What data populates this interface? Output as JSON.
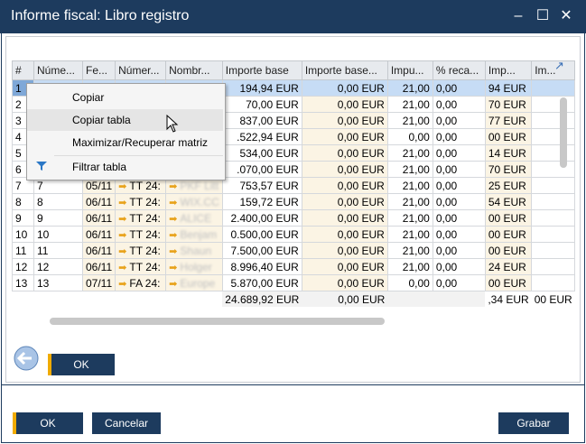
{
  "window": {
    "title": "Informe fiscal: Libro registro"
  },
  "columns": [
    "#",
    "Núme...",
    "Fe...",
    "Númer...",
    "Nombr...",
    "Importe base",
    "Importe base...",
    "Impu...",
    "% reca...",
    "Imp...",
    "Im..."
  ],
  "rows": [
    {
      "n": "1",
      "num": "",
      "fecha": "",
      "numdoc": "",
      "nombre": "",
      "base": "194,94 EUR",
      "base2": "0,00 EUR",
      "imp": "21,00",
      "rec": "0,00",
      "imp2": "94 EUR"
    },
    {
      "n": "2",
      "num": "",
      "fecha": "",
      "numdoc": "",
      "nombre": "",
      "base": "70,00 EUR",
      "base2": "0,00 EUR",
      "imp": "21,00",
      "rec": "0,00",
      "imp2": "70 EUR"
    },
    {
      "n": "3",
      "num": "",
      "fecha": "",
      "numdoc": "",
      "nombre": "",
      "base": "837,00 EUR",
      "base2": "0,00 EUR",
      "imp": "21,00",
      "rec": "0,00",
      "imp2": "77 EUR"
    },
    {
      "n": "4",
      "num": "",
      "fecha": "",
      "numdoc": "",
      "nombre": "",
      "base": ".522,94 EUR",
      "base2": "0,00 EUR",
      "imp": "0,00",
      "rec": "0,00",
      "imp2": "00 EUR"
    },
    {
      "n": "5",
      "num": "",
      "fecha": "",
      "numdoc": "",
      "nombre": "",
      "base": "534,00 EUR",
      "base2": "0,00 EUR",
      "imp": "21,00",
      "rec": "0,00",
      "imp2": "14 EUR"
    },
    {
      "n": "6",
      "num": "",
      "fecha": "",
      "numdoc": "",
      "nombre": "",
      "base": ".070,00 EUR",
      "base2": "0,00 EUR",
      "imp": "21,00",
      "rec": "0,00",
      "imp2": "70 EUR"
    },
    {
      "n": "7",
      "num": "7",
      "fecha": "05/11",
      "numdoc": "TT 24:",
      "nombre": "PKF Litt",
      "base": "753,57 EUR",
      "base2": "0,00 EUR",
      "imp": "21,00",
      "rec": "0,00",
      "imp2": "25 EUR"
    },
    {
      "n": "8",
      "num": "8",
      "fecha": "06/11",
      "numdoc": "TT 24:",
      "nombre": "WIX.CC",
      "base": "159,72 EUR",
      "base2": "0,00 EUR",
      "imp": "21,00",
      "rec": "0,00",
      "imp2": "54 EUR"
    },
    {
      "n": "9",
      "num": "9",
      "fecha": "06/11",
      "numdoc": "TT 24:",
      "nombre": "ALICE",
      "base": "2.400,00 EUR",
      "base2": "0,00 EUR",
      "imp": "21,00",
      "rec": "0,00",
      "imp2": "00 EUR"
    },
    {
      "n": "10",
      "num": "10",
      "fecha": "06/11",
      "numdoc": "TT 24:",
      "nombre": "Benjam",
      "base": "0.500,00 EUR",
      "base2": "0,00 EUR",
      "imp": "21,00",
      "rec": "0,00",
      "imp2": "00 EUR"
    },
    {
      "n": "11",
      "num": "11",
      "fecha": "06/11",
      "numdoc": "TT 24:",
      "nombre": "Shaun",
      "base": "7.500,00 EUR",
      "base2": "0,00 EUR",
      "imp": "21,00",
      "rec": "0,00",
      "imp2": "00 EUR"
    },
    {
      "n": "12",
      "num": "12",
      "fecha": "06/11",
      "numdoc": "TT 24:",
      "nombre": "Holger",
      "base": "8.996,40 EUR",
      "base2": "0,00 EUR",
      "imp": "21,00",
      "rec": "0,00",
      "imp2": "24 EUR"
    },
    {
      "n": "13",
      "num": "13",
      "fecha": "07/11",
      "numdoc": "FA 24:",
      "nombre": "Europe",
      "base": "5.870,00 EUR",
      "base2": "0,00 EUR",
      "imp": "0,00",
      "rec": "0,00",
      "imp2": "00 EUR"
    }
  ],
  "totals": {
    "base": "24.689,92 EUR",
    "base2": "0,00 EUR",
    "imp2": ",34 EUR",
    "im": "00 EUR"
  },
  "context_menu": {
    "items": [
      {
        "label": "Copiar"
      },
      {
        "label": "Copiar tabla"
      },
      {
        "label": "Maximizar/Recuperar matriz"
      },
      {
        "label": "Filtrar tabla"
      }
    ]
  },
  "buttons": {
    "ok_inner": "OK",
    "ok": "OK",
    "cancel": "Cancelar",
    "save": "Grabar"
  },
  "icons": {
    "minimize": "minimize-icon",
    "maximize": "maximize-icon",
    "close": "close-icon",
    "filter": "filter-icon",
    "expand": "expand-icon",
    "back": "back-arrow-icon",
    "link_arrow": "link-arrow-icon"
  },
  "colors": {
    "titlebar": "#1d3b5e",
    "accent": "#f0ab00",
    "selection": "#c6dcf5",
    "tint": "#fbf4e4"
  }
}
